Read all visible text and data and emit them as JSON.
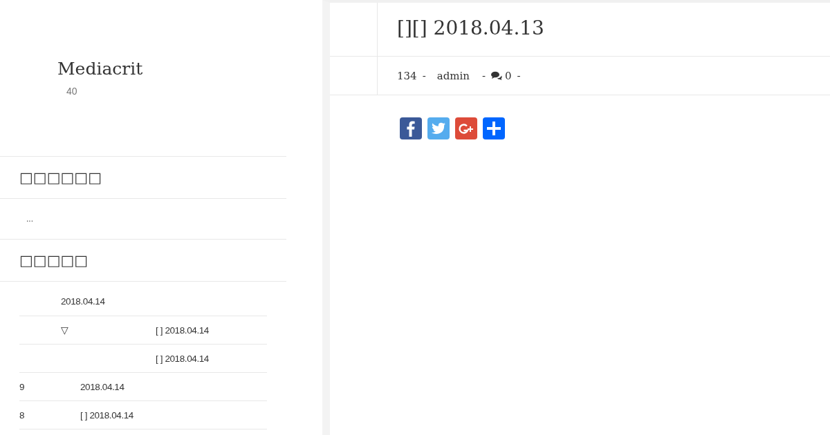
{
  "site": {
    "title": "Mediacrit",
    "subtitle": "40"
  },
  "widgets": [
    {
      "heading": "□□□□□□",
      "body": "..."
    },
    {
      "heading": "□□□□□"
    }
  ],
  "list": {
    "rows": [
      {
        "column_1": "",
        "column_2": "2018.04.14",
        "column_3": ""
      },
      {
        "column_1": "",
        "column_2": "▽",
        "column_3": "[ ] 2018.04.14"
      },
      {
        "column_1": "",
        "column_2": "",
        "column_3": "[ ] 2018.04.14"
      },
      {
        "column_1": "9",
        "column_2": "2018.04.14",
        "column_3": ""
      },
      {
        "column_1": "8",
        "column_2": "[ ] 2018.04.14",
        "column_3": ""
      }
    ]
  },
  "post": {
    "title": "[][] 2018.04.13",
    "meta": {
      "views": "134",
      "author": "admin",
      "comments": "0",
      "separator": "-"
    },
    "share": [
      {
        "kind": "facebook"
      },
      {
        "kind": "twitter"
      },
      {
        "kind": "googleplus"
      },
      {
        "kind": "more"
      }
    ]
  }
}
